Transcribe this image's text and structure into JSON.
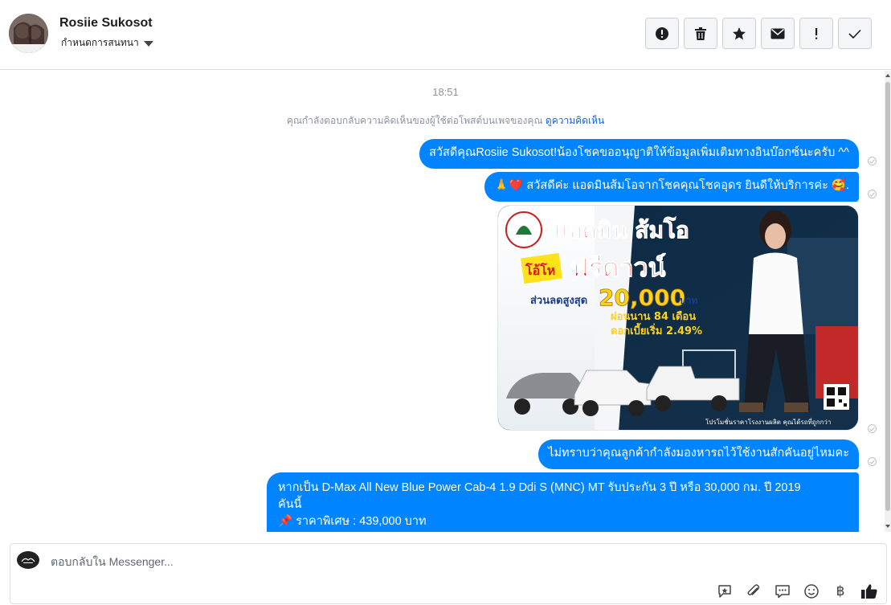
{
  "header": {
    "user_name": "Rosiie Sukosot",
    "assign_label": "กำหนดการสนทนา",
    "toolbar": [
      {
        "name": "report-icon"
      },
      {
        "name": "trash-icon"
      },
      {
        "name": "star-icon"
      },
      {
        "name": "mail-icon"
      },
      {
        "name": "important-icon"
      },
      {
        "name": "done-check-icon"
      }
    ]
  },
  "thread": {
    "timestamp": "18:51",
    "notice_text": "คุณกำลังตอบกลับความคิดเห็นของผู้ใช้ต่อโพสต์บนเพจของคุณ ",
    "notice_link": "ดูความคิดเห็น",
    "messages": [
      {
        "text": "สวัสดีคุณRosiie Sukosot!น้องโชคขออนุญาติให้ข้อมูลเพิ่มเติมทางอินบ๊อกซ์นะครับ ^^"
      },
      {
        "text": "🙏❤️ สวัสดีค่ะ แอดมินส้มโอจากโชคคุณโชคอุดร ยินดีให้บริการค่ะ  🥰."
      },
      {
        "text": "ไม่ทราบว่าคุณลูกค้ากำลังมองหารถไว้ใช้งานสักคันอยู่ไหมคะ"
      },
      {
        "line1": "หากเป็น  D-Max All New Blue Power Cab-4 1.9 Ddi S (MNC) MT รับประกัน 3 ปี หรือ 30,000 กม. ปี 2019",
        "line2": "คันนี้",
        "line3": "📌 ราคาพิเศษ : 439,000 บาท"
      }
    ],
    "promo": {
      "title": "แอดมิน ส้มโอ",
      "badge": "โอ้โห",
      "headline": "ฟรีดาวน์",
      "discount_label": "ส่วนลดสูงสุด",
      "discount_amount": "20,000",
      "discount_unit": "บาท",
      "installment": "ผ่อนนาน 84 เดือน",
      "interest": "ดอกเบี้ยเริ่ม 2.49%",
      "footer": "โปรโมชั่นราคาโรงงานผลิต คุณได้รถที่ถูกกว่า"
    }
  },
  "composer": {
    "placeholder": "ตอบกลับใน Messenger...",
    "tools": [
      "saved-reply-icon",
      "attachment-icon",
      "quick-reply-icon",
      "emoji-icon",
      "baht-payment-icon",
      "like-icon"
    ],
    "baht_symbol": "฿"
  }
}
